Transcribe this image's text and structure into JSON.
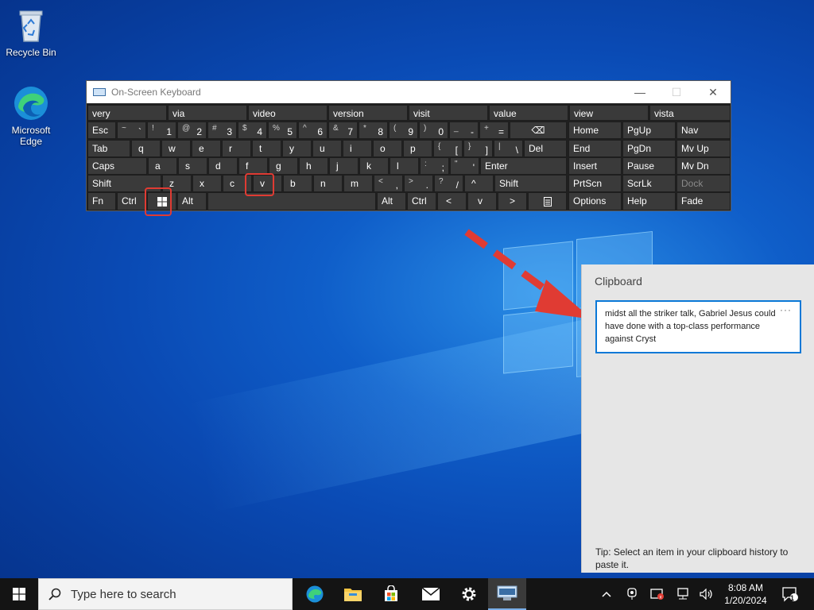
{
  "desktop": {
    "icons": [
      {
        "label": "Recycle Bin",
        "icon": "recycle-bin-icon"
      },
      {
        "label": "Microsoft Edge",
        "icon": "edge-icon"
      }
    ]
  },
  "osk": {
    "title": "On-Screen Keyboard",
    "predictions": [
      "very",
      "via",
      "video",
      "version",
      "visit",
      "value",
      "view",
      "vista"
    ],
    "row1": [
      {
        "sup": "~",
        "main": "`"
      },
      {
        "sup": "!",
        "main": "1"
      },
      {
        "sup": "@",
        "main": "2"
      },
      {
        "sup": "#",
        "main": "3"
      },
      {
        "sup": "$",
        "main": "4"
      },
      {
        "sup": "%",
        "main": "5"
      },
      {
        "sup": "^",
        "main": "6"
      },
      {
        "sup": "&",
        "main": "7"
      },
      {
        "sup": "*",
        "main": "8"
      },
      {
        "sup": "(",
        "main": "9"
      },
      {
        "sup": ")",
        "main": "0"
      },
      {
        "sup": "_",
        "main": "-"
      },
      {
        "sup": "+",
        "main": "="
      }
    ],
    "esc": "Esc",
    "backspace_symbol": "⌫",
    "tab": "Tab",
    "row2": [
      "q",
      "w",
      "e",
      "r",
      "t",
      "y",
      "u",
      "i",
      "o",
      "p"
    ],
    "row2_sym": [
      {
        "sup": "{",
        "main": "["
      },
      {
        "sup": "}",
        "main": "]"
      },
      {
        "sup": "|",
        "main": "\\"
      }
    ],
    "del": "Del",
    "caps": "Caps",
    "row3": [
      "a",
      "s",
      "d",
      "f",
      "g",
      "h",
      "j",
      "k",
      "l"
    ],
    "row3_sym": [
      {
        "sup": ":",
        "main": ";"
      },
      {
        "sup": "\"",
        "main": "'"
      }
    ],
    "enter": "Enter",
    "shift": "Shift",
    "row4": [
      "z",
      "x",
      "c",
      "v",
      "b",
      "n",
      "m"
    ],
    "row4_sym": [
      {
        "sup": "<",
        "main": ","
      },
      {
        "sup": ">",
        "main": "."
      },
      {
        "sup": "?",
        "main": "/"
      }
    ],
    "up_arrow": "^",
    "fn": "Fn",
    "ctrl": "Ctrl",
    "alt": "Alt",
    "left_arrow": "<",
    "down_arrow": "v",
    "right_arrow": ">",
    "nav_keys": [
      [
        "Home",
        "PgUp",
        "Nav"
      ],
      [
        "End",
        "PgDn",
        "Mv Up"
      ],
      [
        "Insert",
        "Pause",
        "Mv Dn"
      ],
      [
        "PrtScn",
        "ScrLk",
        "Dock"
      ],
      [
        "Options",
        "Help",
        "Fade"
      ]
    ]
  },
  "clipboard": {
    "title": "Clipboard",
    "item_text": "midst all the striker talk, Gabriel Jesus could have done with a top-class performance against Cryst",
    "more": "···",
    "tip": "Tip: Select an item in your clipboard history to paste it."
  },
  "taskbar": {
    "search_placeholder": "Type here to search",
    "time": "8:08 AM",
    "date": "1/20/2024",
    "notification_count": "1"
  },
  "colors": {
    "accent": "#0a78d7",
    "highlight_red": "#e03b33",
    "osk_key": "#3a3a3a"
  }
}
